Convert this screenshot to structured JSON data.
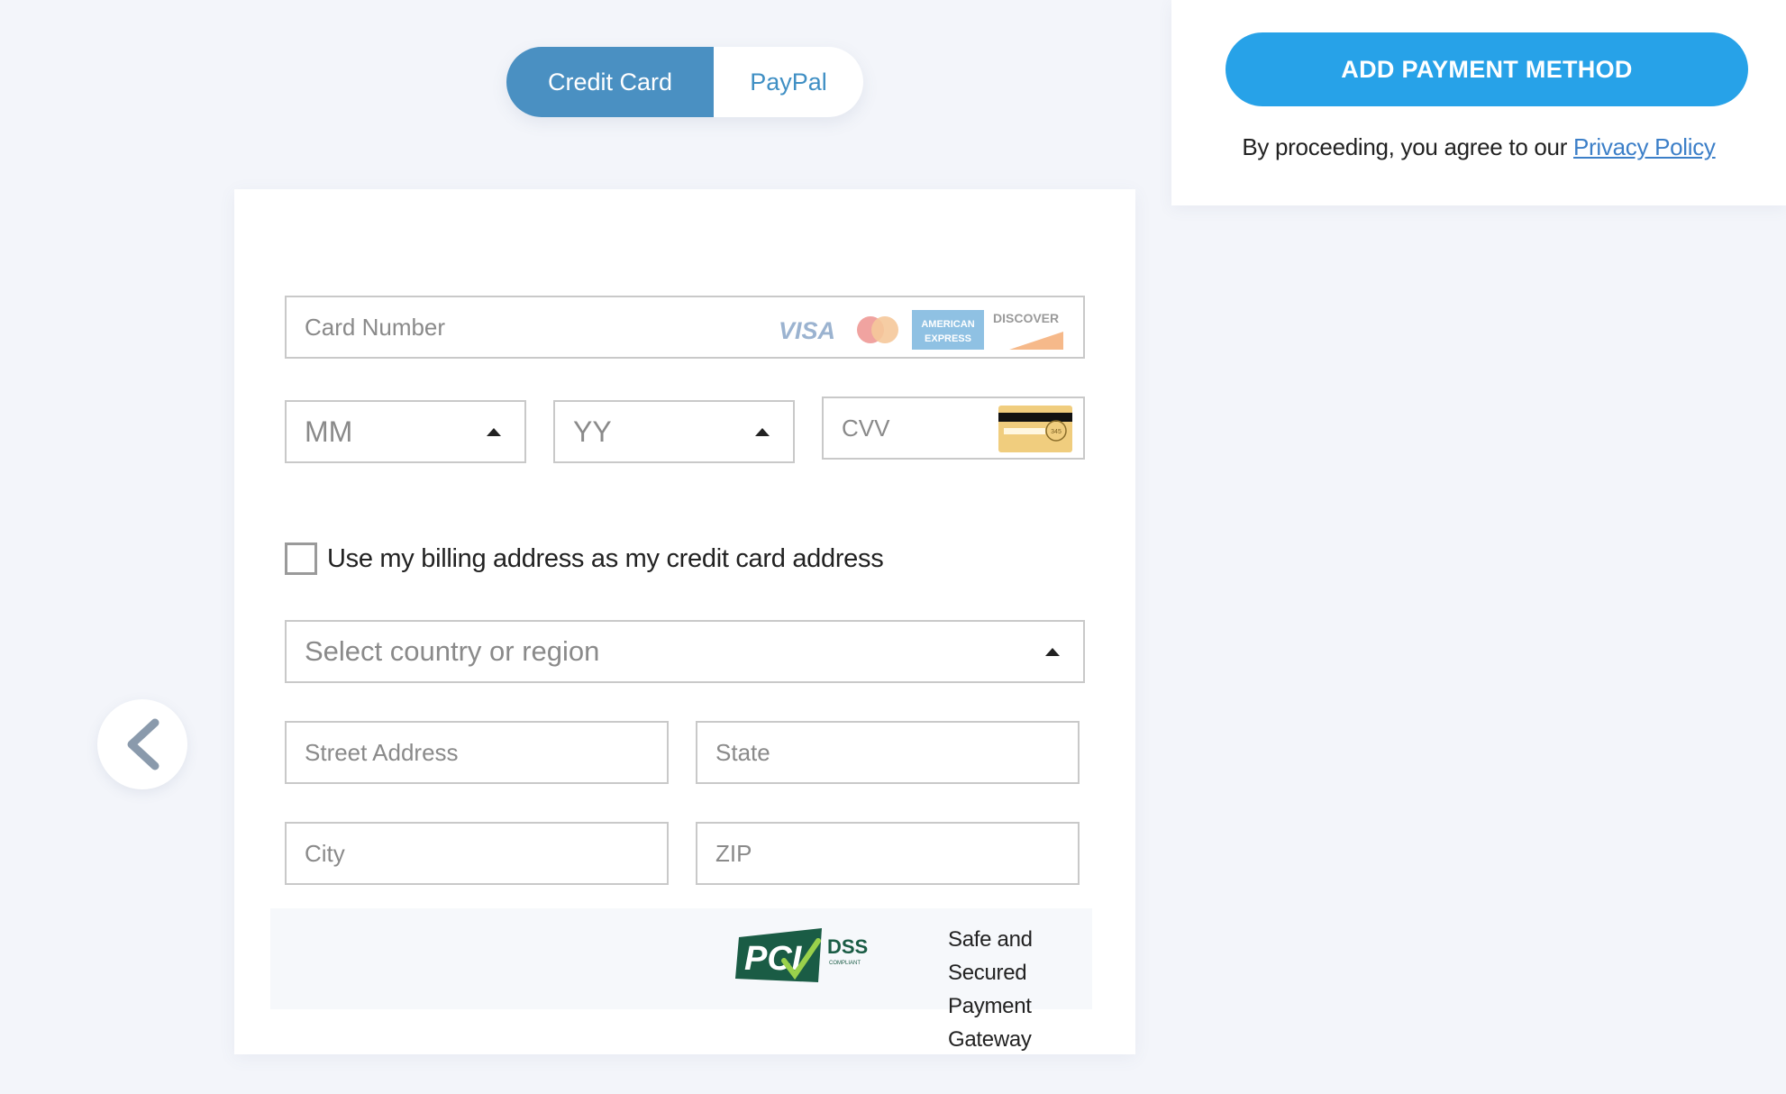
{
  "tabs": [
    {
      "label": "Credit Card",
      "active": true
    },
    {
      "label": "PayPal",
      "active": false
    }
  ],
  "action": {
    "add_button": "ADD PAYMENT METHOD",
    "agree_prefix": "By proceeding, you agree to our ",
    "privacy_link": "Privacy Policy"
  },
  "form": {
    "card_number_placeholder": "Card Number",
    "card_brands": [
      "VISA",
      "MasterCard",
      "AMERICAN EXPRESS",
      "DISCOVER"
    ],
    "month_select": "MM",
    "year_select": "YY",
    "cvv_placeholder": "CVV",
    "cvv_sample": "345",
    "billing_checkbox_label": "Use my billing address as my credit card address",
    "billing_checkbox_checked": false,
    "country_select": "Select country or region",
    "street_placeholder": "Street Address",
    "state_placeholder": "State",
    "city_placeholder": "City",
    "zip_placeholder": "ZIP"
  },
  "security": {
    "pci_text": "PCI",
    "dss_text": "DSS",
    "compliant_text": "COMPLIANT",
    "line1": "Safe and Secured",
    "line2": "Payment Gateway"
  },
  "colors": {
    "background": "#f3f5fa",
    "tab_active": "#4a90c2",
    "tab_inactive_text": "#3f8fc4",
    "primary_button": "#27a2e8",
    "link": "#3c7fc8",
    "pci_green": "#1a5c45"
  },
  "icons": {
    "back": "chevron-left-icon",
    "dropdown": "caret-up-icon"
  }
}
